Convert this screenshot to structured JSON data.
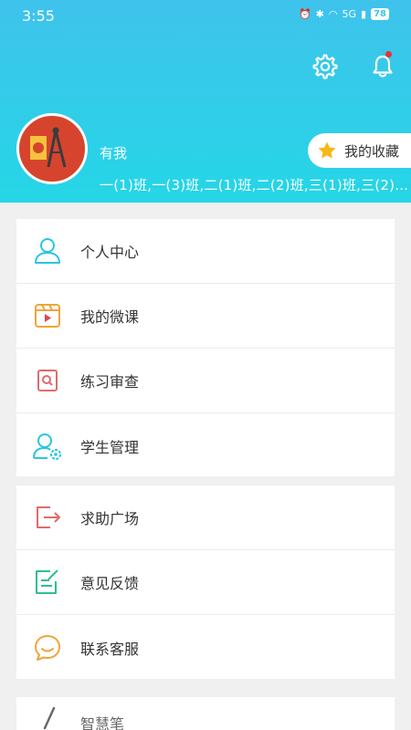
{
  "status": {
    "time": "3:55",
    "signal": "5G",
    "battery": "78"
  },
  "profile": {
    "name": "有我",
    "classes": "一(1)班,一(3)班,二(1)班,二(2)班,三(1)班,三(2)…",
    "favorites_label": "我的收藏"
  },
  "menu_group_1": [
    {
      "label": "个人中心"
    },
    {
      "label": "我的微课"
    },
    {
      "label": "练习审查"
    },
    {
      "label": "学生管理"
    }
  ],
  "menu_group_2": [
    {
      "label": "求助广场"
    },
    {
      "label": "意见反馈"
    },
    {
      "label": "联系客服"
    }
  ],
  "menu_group_3": [
    {
      "label": "智慧笔"
    }
  ],
  "colors": {
    "header_top": "#3fc3ec",
    "header_bottom": "#25d6e6",
    "accent_cyan": "#29c4e0",
    "accent_orange": "#f0a53a",
    "accent_red": "#e06b6b",
    "accent_green": "#2fbf8f",
    "notification_dot": "#e8303a"
  }
}
